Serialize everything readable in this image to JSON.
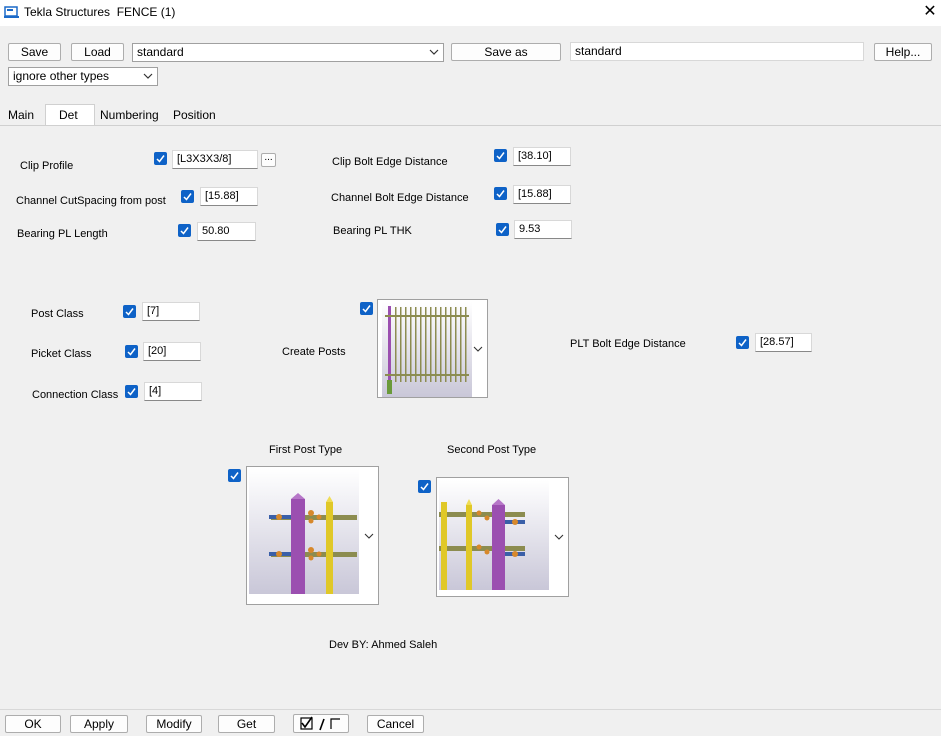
{
  "window": {
    "app": "Tekla Structures",
    "title": "FENCE (1)"
  },
  "toolbar": {
    "save_label": "Save",
    "load_label": "Load",
    "load_combo_value": "standard",
    "save_as_label": "Save as",
    "save_as_value": "standard",
    "help_label": "Help...",
    "filter_value": "ignore other types"
  },
  "tabs": [
    "Main",
    "Det",
    "Numbering",
    "Position"
  ],
  "fields": {
    "clip_profile": {
      "label": "Clip Profile",
      "value": "[L3X3X3/8]",
      "browse": "..."
    },
    "clip_bolt_edge": {
      "label": "Clip Bolt Edge Distance",
      "value": "[38.10]"
    },
    "channel_cut_spacing": {
      "label": "Channel CutSpacing from post",
      "value": "[15.88]"
    },
    "channel_bolt_edge": {
      "label": "Channel Bolt Edge Distance",
      "value": "[15.88]"
    },
    "bearing_pl_length": {
      "label": "Bearing PL Length",
      "value": "50.80"
    },
    "bearing_pl_thk": {
      "label": "Bearing PL THK",
      "value": "9.53"
    },
    "post_class": {
      "label": "Post Class",
      "value": "[7]"
    },
    "picket_class": {
      "label": "Picket Class",
      "value": "[20]"
    },
    "connection_class": {
      "label": "Connection Class",
      "value": "[4]"
    },
    "create_posts": {
      "label": "Create Posts"
    },
    "plt_bolt_edge": {
      "label": "PLT Bolt Edge Distance",
      "value": "[28.57]"
    },
    "first_post_type": {
      "label": "First Post Type"
    },
    "second_post_type": {
      "label": "Second Post Type"
    }
  },
  "credit": "Dev BY: Ahmed Saleh",
  "bottom": {
    "ok": "OK",
    "apply": "Apply",
    "modify": "Modify",
    "get": "Get",
    "cancel": "Cancel"
  },
  "colors": {
    "checkbox": "#0e62c7",
    "post_purple": "#9b4fb0",
    "picket_yellow": "#e0c828",
    "rail_olive": "#8c8c50",
    "clip_blue": "#3a5fa8",
    "bolt_orange": "#d7882b"
  }
}
